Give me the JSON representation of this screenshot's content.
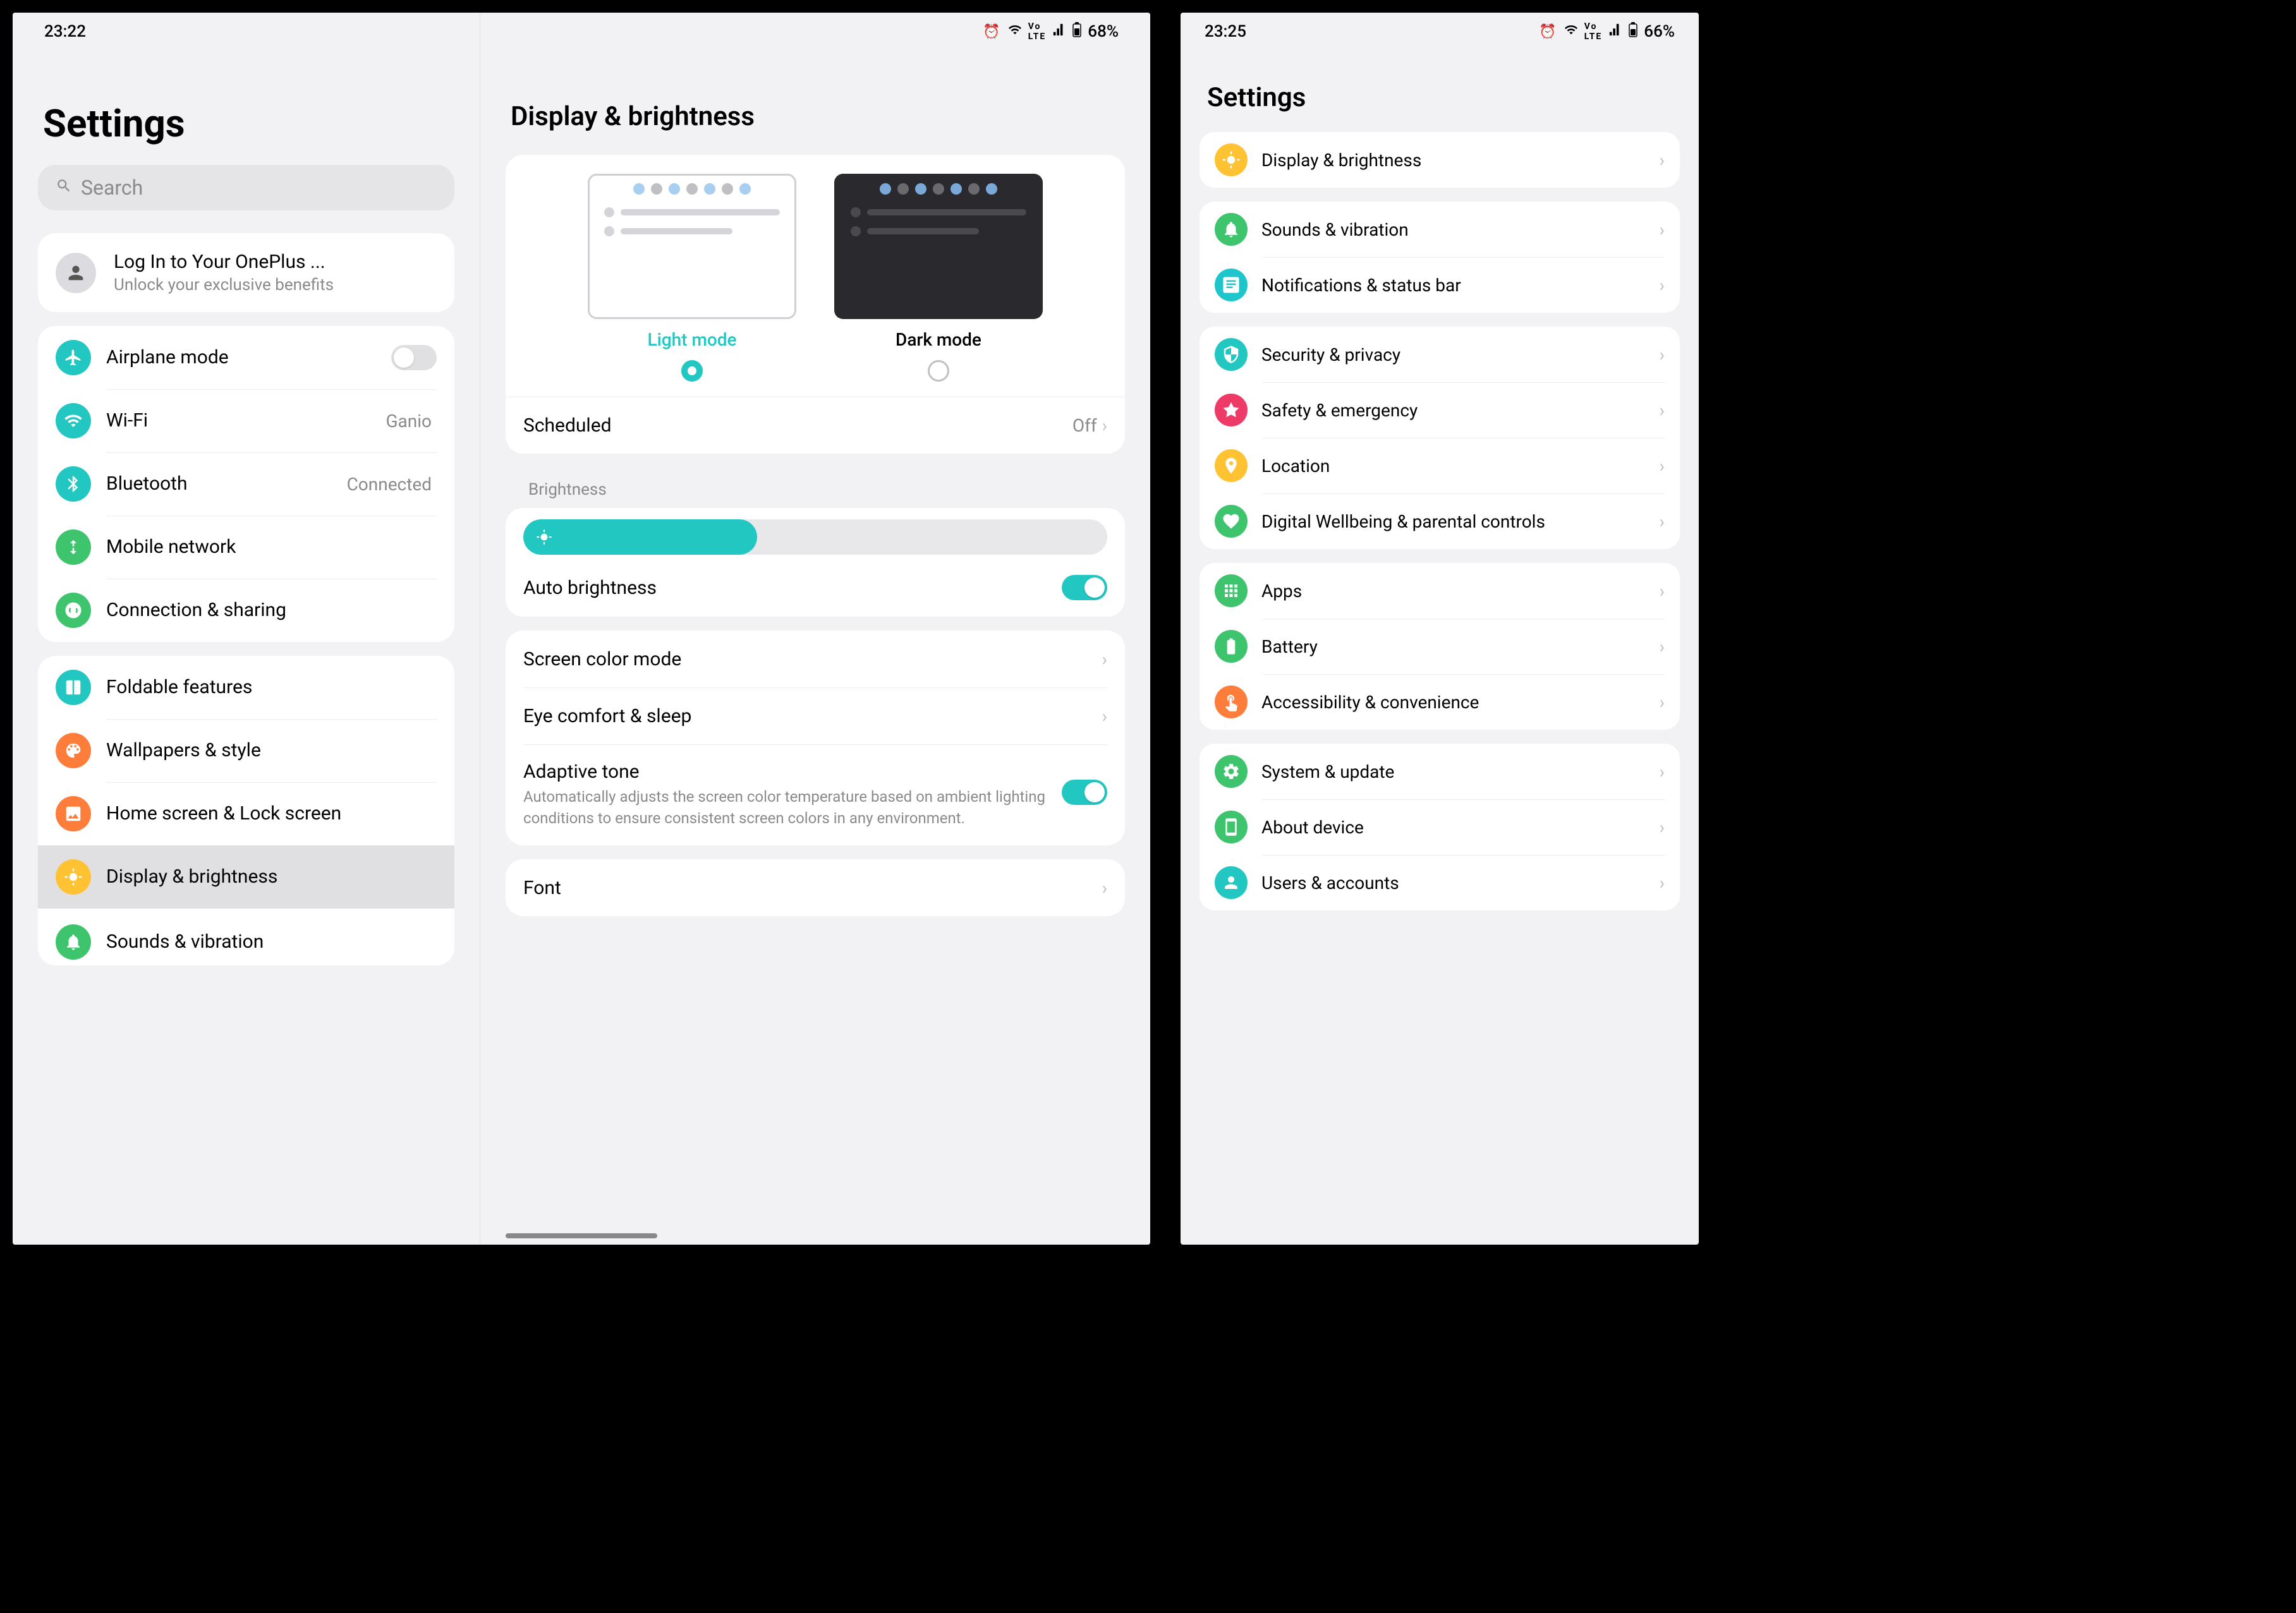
{
  "tablet": {
    "status": {
      "time": "23:22",
      "battery": "68%"
    },
    "sidebar": {
      "title": "Settings",
      "search_placeholder": "Search",
      "account": {
        "title": "Log In to Your OnePlus ...",
        "subtitle": "Unlock your exclusive benefits"
      },
      "group1": {
        "airplane": "Airplane mode",
        "wifi": "Wi-Fi",
        "wifi_value": "Ganio",
        "bluetooth": "Bluetooth",
        "bluetooth_value": "Connected",
        "mobile": "Mobile network",
        "connection": "Connection & sharing"
      },
      "group2": {
        "foldable": "Foldable features",
        "wallpapers": "Wallpapers & style",
        "homescreen": "Home screen & Lock screen",
        "display": "Display & brightness",
        "sounds": "Sounds & vibration"
      }
    },
    "main": {
      "title": "Display & brightness",
      "light_mode": "Light mode",
      "dark_mode": "Dark mode",
      "scheduled": "Scheduled",
      "scheduled_value": "Off",
      "brightness_header": "Brightness",
      "auto_brightness": "Auto brightness",
      "color_mode": "Screen color mode",
      "eye_comfort": "Eye comfort & sleep",
      "adaptive_tone": "Adaptive tone",
      "adaptive_desc": "Automatically adjusts the screen color temperature based on ambient lighting conditions to ensure consistent screen colors in any environment.",
      "font": "Font"
    }
  },
  "phone": {
    "status": {
      "time": "23:25",
      "battery": "66%"
    },
    "title": "Settings",
    "items": {
      "display": "Display & brightness",
      "sounds": "Sounds & vibration",
      "notifications": "Notifications & status bar",
      "security": "Security & privacy",
      "safety": "Safety & emergency",
      "location": "Location",
      "wellbeing": "Digital Wellbeing & parental controls",
      "apps": "Apps",
      "battery": "Battery",
      "accessibility": "Accessibility & convenience",
      "system": "System & update",
      "about": "About device",
      "users": "Users & accounts"
    }
  }
}
